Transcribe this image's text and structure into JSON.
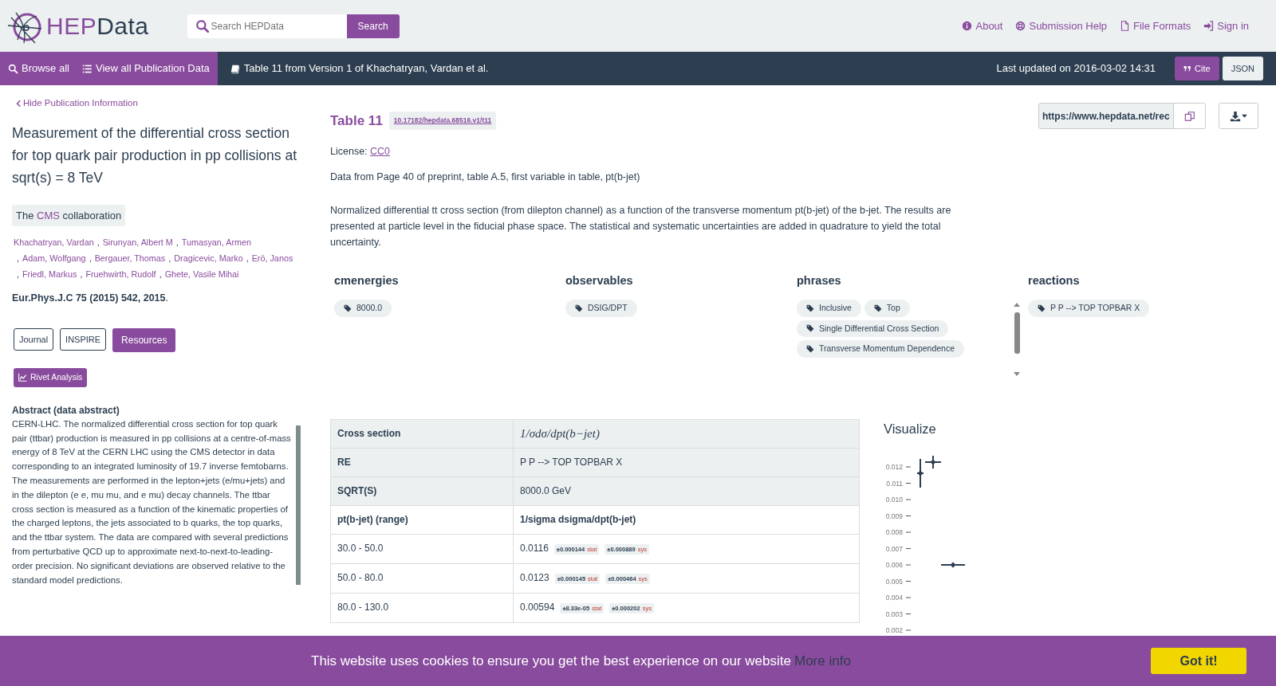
{
  "header": {
    "logo": {
      "part1": "HEP",
      "part2": "Data"
    },
    "search": {
      "placeholder": "Search HEPData",
      "button": "Search"
    },
    "links": [
      "About",
      "Submission Help",
      "File Formats",
      "Sign in"
    ]
  },
  "navbar": {
    "links": [
      "Browse all",
      "View all Publication Data"
    ],
    "title": "Table 11 from Version 1 of Khachatryan, Vardan et al.",
    "updated": "Last updated on 2016-03-02 14:31",
    "buttons": [
      {
        "label": "Cite",
        "kind": "primary"
      },
      {
        "label": "JSON",
        "kind": "light"
      }
    ]
  },
  "sidebar": {
    "hide_link": "Hide Publication Information",
    "title": "Measurement of the differential cross section for top quark pair production in pp collisions at sqrt(s) = 8 TeV",
    "collaboration": {
      "prefix": "The",
      "name": "CMS",
      "suffix": "collaboration"
    },
    "authors": [
      "Khachatryan, Vardan",
      "Sirunyan, Albert M",
      "Tumasyan, Armen",
      "Adam, Wolfgang",
      "Bergauer, Thomas",
      "Dragicevic, Marko",
      "Erö, Janos",
      "Friedl, Markus",
      "Fruehwirth, Rudolf",
      "Ghete, Vasile Mihai"
    ],
    "author_separator": ",",
    "journal": "**Eur.Phys.J.C 75 (2015) 542, 2015**.",
    "buttons": [
      {
        "label": "Journal",
        "kind": "outline"
      },
      {
        "label": "INSPIRE",
        "kind": "outline"
      },
      {
        "label": "Resources",
        "kind": "primary"
      }
    ],
    "rivet": "Rivet Analysis",
    "abstract_title": "Abstract (data abstract)",
    "abstract": "CERN-LHC.  The normalized differential cross section for top quark pair (ttbar) production is measured in pp collisions at a centre-of-mass energy of 8 TeV at the CERN LHC using the CMS detector in data corresponding to an integrated luminosity of 19.7 inverse femtobarns. The measurements are performed in the lepton+jets (e/mu+jets) and in the dilepton (e e, mu mu, and e mu) decay channels. The ttbar cross section is measured as a function of the kinematic properties of the charged leptons, the jets associated to b quarks, the top quarks, and the ttbar system. The data are compared with several predictions from perturbative QCD up to approximate next-to-next-to-leading-order precision. No significant deviations are observed relative to the standard model predictions."
  },
  "table_info": {
    "name": "Table 11",
    "doi": "10.17182/hepdata.68516.v1/t11",
    "url": "https://www.hepdata.net/rec",
    "license_label": "License:",
    "license": "CC0",
    "location": "Data from Page 40 of preprint, table A.5, first variable in table, pt(b-jet)",
    "description": "Normalized differential tt cross section (from dilepton channel) as a function of the transverse momentum pt(b-jet) of the b-jet. The results are presented at particle level in the fiducial phase space. The statistical and systematic uncertainties are added in quadrature to yield the total uncertainty."
  },
  "keywords": [
    {
      "title": "cmenergies",
      "tags": [
        "8000.0"
      ]
    },
    {
      "title": "observables",
      "tags": [
        "DSIG/DPT"
      ]
    },
    {
      "title": "phrases",
      "tags": [
        "Inclusive",
        "Top",
        "Single Differential Cross Section",
        "Transverse Momentum Dependence"
      ]
    },
    {
      "title": "reactions",
      "tags": [
        "P P --> TOP TOPBAR X"
      ]
    }
  ],
  "table": {
    "qualifiers": [
      {
        "label": "Cross section",
        "value": "1/σdσ/dpt(b−jet)",
        "kind": "math"
      },
      {
        "label": "RE",
        "value": "P P --> TOP TOPBAR X",
        "kind": "text"
      },
      {
        "label": "SQRT(S)",
        "value": "8000.0 GeV",
        "kind": "text"
      }
    ],
    "columns": [
      "pt(b-jet) (range)",
      "1/sigma dsigma/dpt(b-jet)"
    ],
    "rows": [
      {
        "x": "30.0 - 50.0",
        "value": "0.0116",
        "errors": [
          {
            "amount": "±0.000144",
            "source": "stat"
          },
          {
            "amount": "±0.000889",
            "source": "sys"
          }
        ]
      },
      {
        "x": "50.0 - 80.0",
        "value": "0.0123",
        "errors": [
          {
            "amount": "±0.000145",
            "source": "stat"
          },
          {
            "amount": "±0.000464",
            "source": "sys"
          }
        ]
      },
      {
        "x": "80.0 - 130.0",
        "value": "0.00594",
        "errors": [
          {
            "amount": "±8.33e-05",
            "source": "stat"
          },
          {
            "amount": "±0.000202",
            "source": "sys"
          }
        ]
      }
    ]
  },
  "visualize": {
    "title": "Visualize",
    "axis_labels": [
      "0.012",
      "0.011",
      "0.010",
      "0.009",
      "0.008",
      "0.007",
      "0.006",
      "0.005",
      "0.004",
      "0.003",
      "0.002"
    ]
  },
  "cookie": {
    "text": "This website uses cookies to ensure you get the best experience on our website",
    "link": "More info",
    "button": "Got it!"
  }
}
